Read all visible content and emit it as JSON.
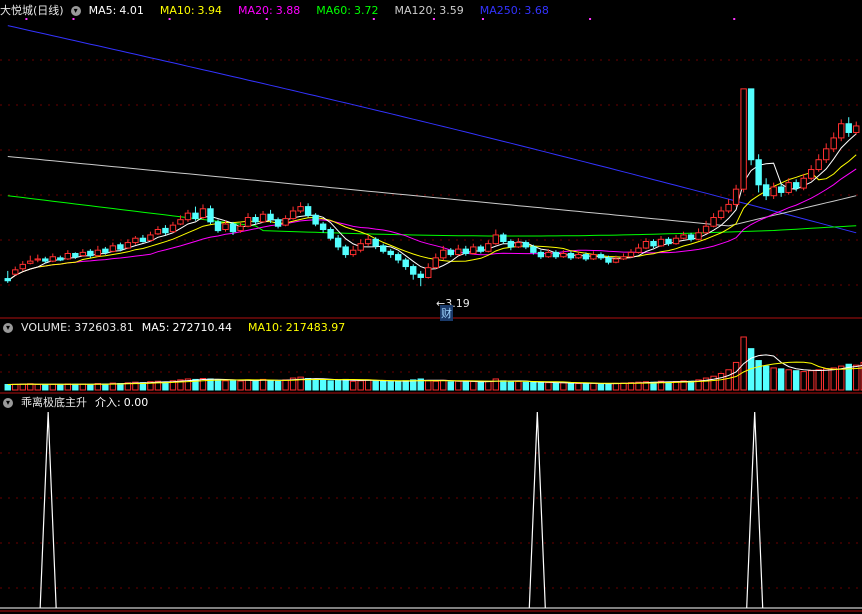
{
  "chart_data": [
    {
      "type": "candlestick",
      "title": "大悦城(日线)",
      "ma_legend": [
        {
          "label": "MA5:",
          "value": "4.01",
          "color": "#ffffff"
        },
        {
          "label": "MA10:",
          "value": "3.94",
          "color": "#ffff00"
        },
        {
          "label": "MA20:",
          "value": "3.88",
          "color": "#ff00ff"
        },
        {
          "label": "MA60:",
          "value": "3.72",
          "color": "#00ff00"
        },
        {
          "label": "MA120:",
          "value": "3.59",
          "color": "#cccccc"
        },
        {
          "label": "MA250:",
          "value": "3.68",
          "color": "#3333ff"
        }
      ],
      "low_marker": "3.19",
      "event_marker": "财",
      "ylim": [
        3.1,
        5.65
      ],
      "candles": [
        [
          3.26,
          3.24,
          3.33,
          3.22
        ],
        [
          3.3,
          3.34,
          3.37,
          3.29
        ],
        [
          3.35,
          3.39,
          3.42,
          3.33
        ],
        [
          3.4,
          3.42,
          3.47,
          3.39
        ],
        [
          3.43,
          3.44,
          3.48,
          3.41
        ],
        [
          3.44,
          3.42,
          3.46,
          3.4
        ],
        [
          3.42,
          3.46,
          3.49,
          3.41
        ],
        [
          3.45,
          3.43,
          3.47,
          3.42
        ],
        [
          3.44,
          3.49,
          3.52,
          3.43
        ],
        [
          3.49,
          3.46,
          3.5,
          3.44
        ],
        [
          3.47,
          3.5,
          3.53,
          3.46
        ],
        [
          3.51,
          3.47,
          3.53,
          3.45
        ],
        [
          3.47,
          3.52,
          3.56,
          3.46
        ],
        [
          3.53,
          3.5,
          3.55,
          3.48
        ],
        [
          3.51,
          3.56,
          3.59,
          3.5
        ],
        [
          3.57,
          3.53,
          3.59,
          3.51
        ],
        [
          3.54,
          3.59,
          3.62,
          3.53
        ],
        [
          3.59,
          3.63,
          3.65,
          3.57
        ],
        [
          3.63,
          3.6,
          3.66,
          3.59
        ],
        [
          3.61,
          3.66,
          3.69,
          3.6
        ],
        [
          3.67,
          3.71,
          3.74,
          3.66
        ],
        [
          3.72,
          3.68,
          3.75,
          3.66
        ],
        [
          3.69,
          3.75,
          3.78,
          3.68
        ],
        [
          3.76,
          3.8,
          3.84,
          3.75
        ],
        [
          3.8,
          3.86,
          3.89,
          3.78
        ],
        [
          3.86,
          3.81,
          3.92,
          3.79
        ],
        [
          3.82,
          3.9,
          3.94,
          3.8
        ],
        [
          3.9,
          3.78,
          3.93,
          3.76
        ],
        [
          3.78,
          3.7,
          3.8,
          3.68
        ],
        [
          3.71,
          3.76,
          3.79,
          3.69
        ],
        [
          3.76,
          3.69,
          3.78,
          3.66
        ],
        [
          3.7,
          3.74,
          3.77,
          3.68
        ],
        [
          3.74,
          3.82,
          3.86,
          3.73
        ],
        [
          3.82,
          3.78,
          3.85,
          3.76
        ],
        [
          3.78,
          3.85,
          3.88,
          3.77
        ],
        [
          3.85,
          3.8,
          3.89,
          3.77
        ],
        [
          3.8,
          3.74,
          3.82,
          3.72
        ],
        [
          3.75,
          3.81,
          3.84,
          3.74
        ],
        [
          3.81,
          3.88,
          3.92,
          3.8
        ],
        [
          3.88,
          3.92,
          3.96,
          3.86
        ],
        [
          3.92,
          3.84,
          3.95,
          3.82
        ],
        [
          3.84,
          3.76,
          3.86,
          3.74
        ],
        [
          3.76,
          3.71,
          3.78,
          3.68
        ],
        [
          3.71,
          3.63,
          3.73,
          3.61
        ],
        [
          3.63,
          3.55,
          3.66,
          3.52
        ],
        [
          3.55,
          3.48,
          3.57,
          3.45
        ],
        [
          3.48,
          3.52,
          3.56,
          3.46
        ],
        [
          3.52,
          3.58,
          3.62,
          3.5
        ],
        [
          3.58,
          3.62,
          3.66,
          3.56
        ],
        [
          3.62,
          3.56,
          3.64,
          3.53
        ],
        [
          3.56,
          3.51,
          3.58,
          3.49
        ],
        [
          3.51,
          3.48,
          3.53,
          3.45
        ],
        [
          3.48,
          3.43,
          3.5,
          3.4
        ],
        [
          3.43,
          3.37,
          3.45,
          3.34
        ],
        [
          3.37,
          3.3,
          3.39,
          3.25
        ],
        [
          3.3,
          3.27,
          3.33,
          3.19
        ],
        [
          3.27,
          3.36,
          3.4,
          3.26
        ],
        [
          3.36,
          3.45,
          3.49,
          3.35
        ],
        [
          3.45,
          3.52,
          3.56,
          3.43
        ],
        [
          3.52,
          3.48,
          3.54,
          3.46
        ],
        [
          3.48,
          3.53,
          3.57,
          3.47
        ],
        [
          3.53,
          3.49,
          3.56,
          3.47
        ],
        [
          3.49,
          3.55,
          3.58,
          3.48
        ],
        [
          3.55,
          3.51,
          3.57,
          3.49
        ],
        [
          3.51,
          3.58,
          3.61,
          3.5
        ],
        [
          3.58,
          3.66,
          3.71,
          3.57
        ],
        [
          3.66,
          3.6,
          3.68,
          3.58
        ],
        [
          3.6,
          3.55,
          3.62,
          3.52
        ],
        [
          3.55,
          3.59,
          3.63,
          3.54
        ],
        [
          3.59,
          3.55,
          3.61,
          3.53
        ],
        [
          3.55,
          3.5,
          3.57,
          3.48
        ],
        [
          3.5,
          3.46,
          3.52,
          3.44
        ],
        [
          3.46,
          3.5,
          3.53,
          3.45
        ],
        [
          3.5,
          3.46,
          3.52,
          3.44
        ],
        [
          3.46,
          3.49,
          3.52,
          3.45
        ],
        [
          3.49,
          3.45,
          3.51,
          3.43
        ],
        [
          3.45,
          3.48,
          3.51,
          3.44
        ],
        [
          3.48,
          3.44,
          3.5,
          3.42
        ],
        [
          3.44,
          3.48,
          3.51,
          3.43
        ],
        [
          3.48,
          3.45,
          3.5,
          3.43
        ],
        [
          3.45,
          3.41,
          3.47,
          3.39
        ],
        [
          3.41,
          3.44,
          3.47,
          3.4
        ],
        [
          3.44,
          3.46,
          3.49,
          3.43
        ],
        [
          3.46,
          3.5,
          3.53,
          3.45
        ],
        [
          3.5,
          3.54,
          3.58,
          3.49
        ],
        [
          3.54,
          3.6,
          3.63,
          3.53
        ],
        [
          3.6,
          3.56,
          3.62,
          3.54
        ],
        [
          3.56,
          3.62,
          3.65,
          3.55
        ],
        [
          3.62,
          3.58,
          3.64,
          3.56
        ],
        [
          3.58,
          3.63,
          3.66,
          3.57
        ],
        [
          3.63,
          3.66,
          3.69,
          3.62
        ],
        [
          3.66,
          3.62,
          3.68,
          3.6
        ],
        [
          3.62,
          3.68,
          3.72,
          3.61
        ],
        [
          3.68,
          3.74,
          3.79,
          3.67
        ],
        [
          3.74,
          3.82,
          3.86,
          3.73
        ],
        [
          3.82,
          3.88,
          3.92,
          3.8
        ],
        [
          3.88,
          3.94,
          3.99,
          3.86
        ],
        [
          3.94,
          4.08,
          4.12,
          3.92
        ],
        [
          4.08,
          5.0,
          5.0,
          4.05
        ],
        [
          5.0,
          4.35,
          5.0,
          4.3
        ],
        [
          4.35,
          4.12,
          4.4,
          4.05
        ],
        [
          4.12,
          4.02,
          4.18,
          3.98
        ],
        [
          4.02,
          4.1,
          4.14,
          3.99
        ],
        [
          4.1,
          4.05,
          4.13,
          4.01
        ],
        [
          4.05,
          4.14,
          4.18,
          4.03
        ],
        [
          4.14,
          4.09,
          4.17,
          4.06
        ],
        [
          4.09,
          4.18,
          4.22,
          4.07
        ],
        [
          4.18,
          4.26,
          4.3,
          4.16
        ],
        [
          4.26,
          4.35,
          4.4,
          4.24
        ],
        [
          4.35,
          4.45,
          4.5,
          4.32
        ],
        [
          4.45,
          4.55,
          4.6,
          4.42
        ],
        [
          4.55,
          4.68,
          4.72,
          4.52
        ],
        [
          4.68,
          4.6,
          4.74,
          4.56
        ],
        [
          4.6,
          4.66,
          4.7,
          4.58
        ]
      ]
    },
    {
      "type": "bar",
      "title": "VOLUME: 372603.81",
      "ma_legend": [
        {
          "label": "MA5:",
          "value": "272710.44",
          "color": "#ffffff"
        },
        {
          "label": "MA10:",
          "value": "217483.97",
          "color": "#ffff00"
        }
      ],
      "ylim": [
        0,
        620000
      ],
      "values": [
        60000,
        62000,
        65000,
        68000,
        60000,
        58000,
        62000,
        60000,
        66000,
        62000,
        64000,
        60000,
        70000,
        65000,
        75000,
        70000,
        78000,
        85000,
        80000,
        90000,
        95000,
        88000,
        100000,
        110000,
        120000,
        115000,
        125000,
        120000,
        110000,
        100000,
        105000,
        98000,
        110000,
        100000,
        115000,
        105000,
        95000,
        110000,
        130000,
        140000,
        125000,
        115000,
        105000,
        100000,
        110000,
        115000,
        95000,
        100000,
        110000,
        100000,
        95000,
        90000,
        95000,
        100000,
        110000,
        120000,
        100000,
        95000,
        105000,
        90000,
        95000,
        88000,
        92000,
        85000,
        95000,
        120000,
        100000,
        90000,
        92000,
        85000,
        82000,
        78000,
        80000,
        75000,
        78000,
        72000,
        70000,
        68000,
        72000,
        70000,
        68000,
        72000,
        75000,
        80000,
        85000,
        90000,
        85000,
        95000,
        88000,
        92000,
        100000,
        95000,
        110000,
        130000,
        150000,
        180000,
        220000,
        300000,
        580000,
        450000,
        320000,
        260000,
        240000,
        230000,
        220000,
        210000,
        200000,
        210000,
        220000,
        230000,
        240000,
        260000,
        280000,
        270000,
        300000
      ]
    },
    {
      "type": "line",
      "title": "乖离极底主升",
      "ma_legend": [
        {
          "label": "介入:",
          "value": "0.00",
          "color": "#ffffff"
        }
      ],
      "ylim": [
        0,
        1
      ],
      "spikes": [
        6,
        78,
        110
      ],
      "count": 126
    }
  ]
}
